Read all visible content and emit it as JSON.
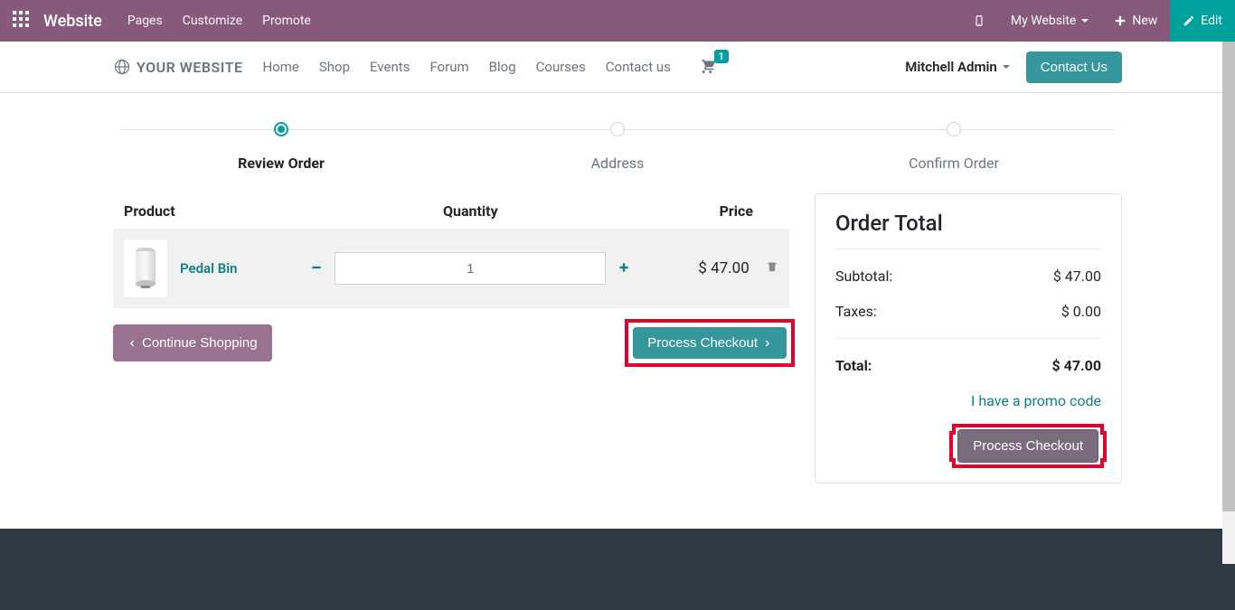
{
  "topbar": {
    "brand": "Website",
    "menu": [
      "Pages",
      "Customize",
      "Promote"
    ],
    "my_website": "My Website",
    "new": "New",
    "edit": "Edit"
  },
  "subnav": {
    "logo_text": "YOUR WEBSITE",
    "items": [
      "Home",
      "Shop",
      "Events",
      "Forum",
      "Blog",
      "Courses",
      "Contact us"
    ],
    "cart_count": "1",
    "user": "Mitchell Admin",
    "contact_btn": "Contact Us"
  },
  "steps": {
    "review": "Review Order",
    "address": "Address",
    "confirm": "Confirm Order"
  },
  "table": {
    "headers": {
      "product": "Product",
      "quantity": "Quantity",
      "price": "Price"
    },
    "item": {
      "name": "Pedal Bin",
      "qty": "1",
      "price": "$ 47.00"
    }
  },
  "actions": {
    "continue": "Continue Shopping",
    "process": "Process Checkout"
  },
  "summary": {
    "title": "Order Total",
    "subtotal_label": "Subtotal:",
    "subtotal_value": "$ 47.00",
    "taxes_label": "Taxes:",
    "taxes_value": "$ 0.00",
    "total_label": "Total:",
    "total_value": "$ 47.00",
    "promo": "I have a promo code",
    "checkout_btn": "Process Checkout"
  }
}
